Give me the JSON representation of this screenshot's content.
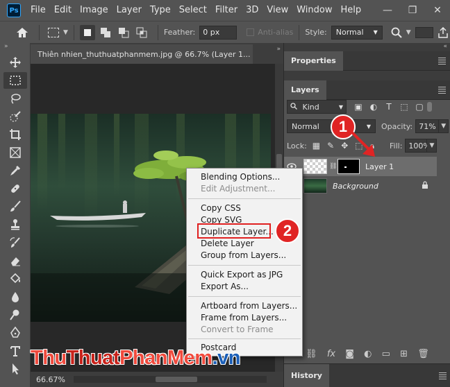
{
  "app": {
    "logo": "Ps"
  },
  "menu": [
    "File",
    "Edit",
    "Image",
    "Layer",
    "Type",
    "Select",
    "Filter",
    "3D",
    "View",
    "Window",
    "Help"
  ],
  "window_controls": {
    "minimize": "—",
    "restore": "❐",
    "close": "✕"
  },
  "options": {
    "feather_label": "Feather:",
    "feather_value": "0 px",
    "antialias_label": "Anti-alias",
    "style_label": "Style:",
    "style_value": "Normal"
  },
  "document": {
    "tab_title": "Thiên nhien_thuthuatphanmem.jpg @ 66.7% (Layer 1...",
    "zoom": "66.67%"
  },
  "panels": {
    "properties_tab": "Properties",
    "layers_tab": "Layers",
    "history_tab": "History",
    "kind_label": "Kind",
    "blend_mode": "Normal",
    "opacity_label": "Opacity:",
    "opacity_value": "71%",
    "lock_label": "Lock:",
    "fill_label": "Fill:",
    "fill_value": "100%",
    "layers": [
      {
        "name": "Layer 1",
        "selected": true
      },
      {
        "name": "Background",
        "selected": false
      }
    ]
  },
  "context_menu": {
    "items": [
      {
        "label": "Blending Options...",
        "disabled": false
      },
      {
        "label": "Edit Adjustment...",
        "disabled": true
      },
      {
        "label": "Copy CSS",
        "disabled": false
      },
      {
        "label": "Copy SVG",
        "disabled": false
      },
      {
        "label": "Duplicate Layer...",
        "disabled": false
      },
      {
        "label": "Delete Layer",
        "disabled": false
      },
      {
        "label": "Group from Layers...",
        "disabled": false
      },
      {
        "label": "Quick Export as JPG",
        "disabled": false
      },
      {
        "label": "Export As...",
        "disabled": false
      },
      {
        "label": "Artboard from Layers...",
        "disabled": false
      },
      {
        "label": "Frame from Layers...",
        "disabled": false
      },
      {
        "label": "Convert to Frame",
        "disabled": true
      },
      {
        "label": "Postcard",
        "disabled": false
      }
    ]
  },
  "annotations": {
    "step1": "1",
    "step2": "2"
  },
  "watermark": {
    "part1": "Thu",
    "part2": "Thuat",
    "part3": "PhanMem",
    "part4": ".vn"
  },
  "colors": {
    "highlight": "#e02020",
    "badge": "#e02424",
    "panel_bg": "#535353",
    "menu_bg": "#f2f2f2"
  }
}
